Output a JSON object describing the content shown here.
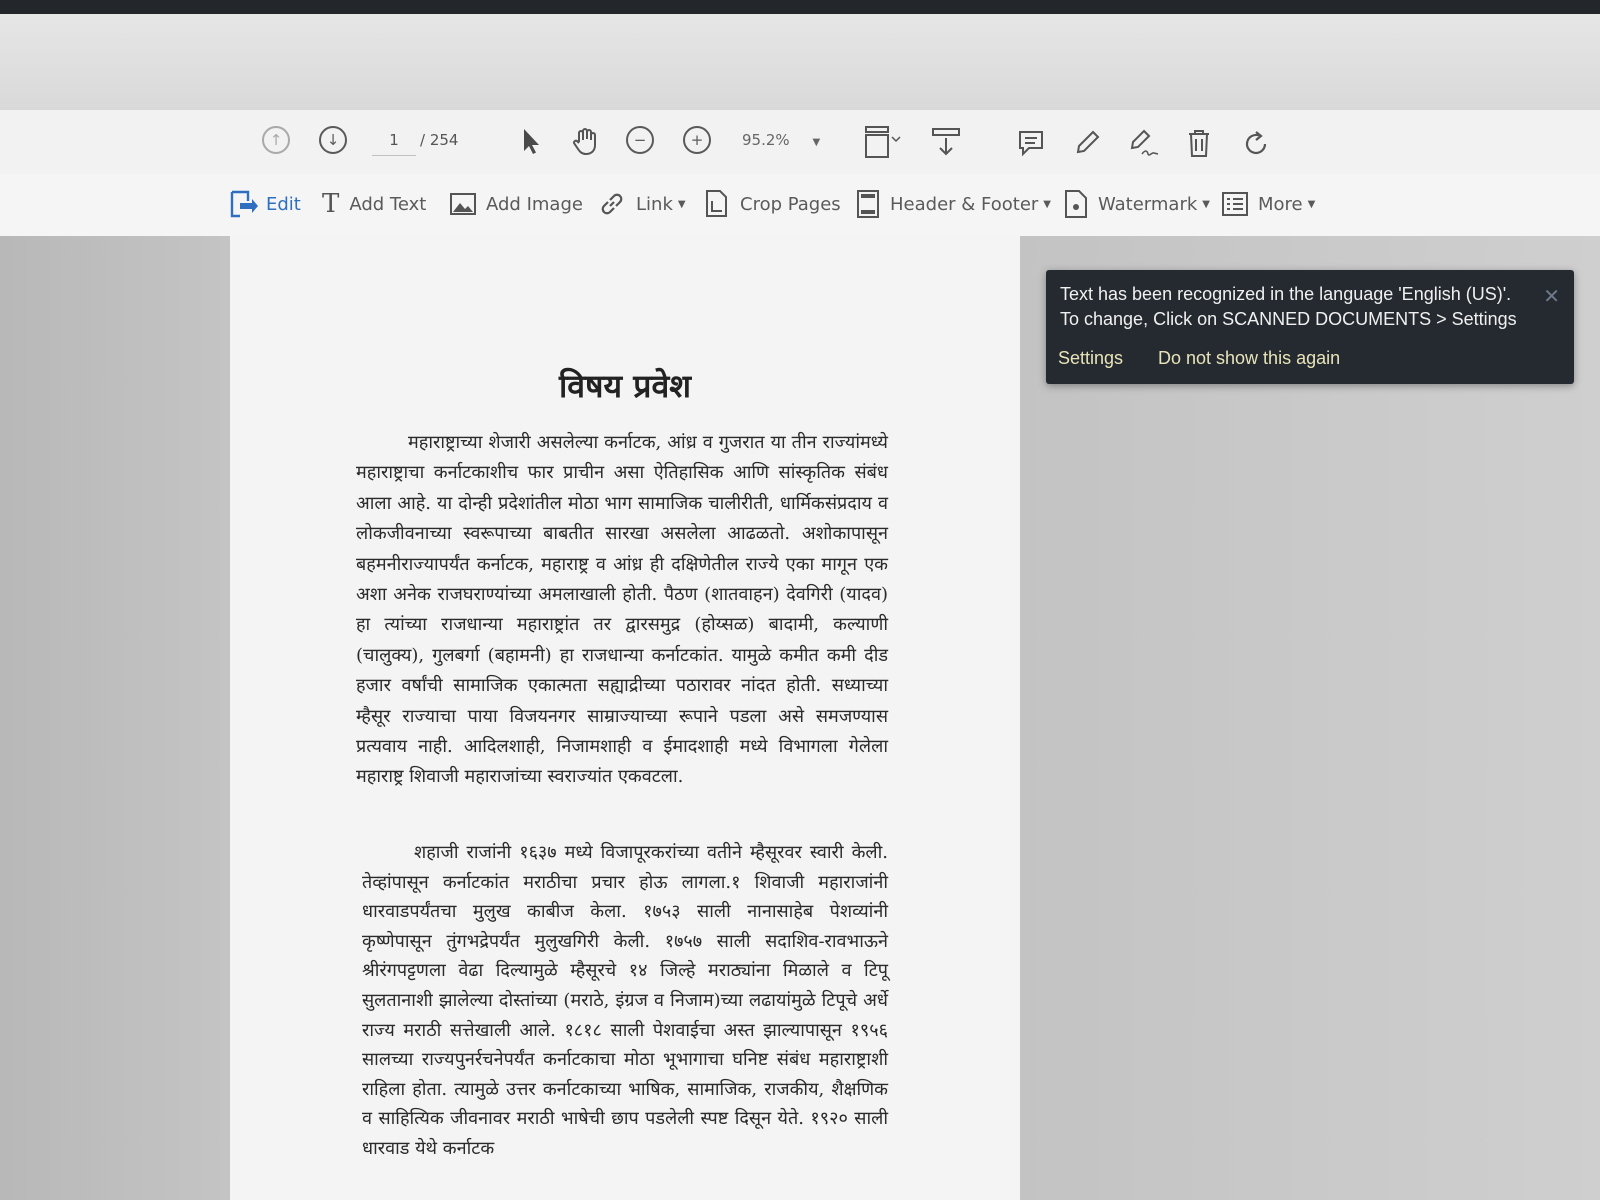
{
  "toolbar": {
    "page_current": "1",
    "page_total": "/ 254",
    "zoom": "95.2%",
    "icons": [
      "prev-page-icon",
      "next-page-icon",
      "select-arrow-icon",
      "hand-icon",
      "zoom-out-icon",
      "zoom-in-icon",
      "fit-page-icon",
      "scroll-mode-icon",
      "comment-icon",
      "highlight-pen-icon",
      "sign-icon",
      "delete-icon",
      "rotate-icon"
    ]
  },
  "edit_toolbar": {
    "edit": "Edit",
    "add_text": "Add Text",
    "add_image": "Add Image",
    "link": "Link",
    "crop_pages": "Crop Pages",
    "header_footer": "Header & Footer",
    "watermark": "Watermark",
    "more": "More"
  },
  "document": {
    "title": "विषय प्रवेश",
    "paragraph1": "महाराष्ट्राच्या शेजारी असलेल्या कर्नाटक, आंध्र व गुजरात या तीन राज्यांमध्ये महाराष्ट्राचा कर्नाटकाशीच फार प्राचीन असा ऐतिहासिक आणि सांस्कृतिक संबंध आला आहे. या दोन्ही प्रदेशांतील मोठा भाग सामाजिक चालीरीती, धार्मिकसंप्रदाय व लोकजीवनाच्या स्वरूपाच्या बाबतीत सारखा असलेला आढळतो. अशोकापासून बहमनीराज्यापर्यंत कर्नाटक, महाराष्ट्र व आंध्र ही दक्षिणेतील राज्ये एका मागून एक अशा अनेक राजघराण्यांच्या अमलाखाली होती. पैठण (शातवाहन) देवगिरी (यादव) हा त्यांच्या राजधान्या महाराष्ट्रांत तर द्वारसमुद्र (होय्सळ) बादामी, कल्याणी (चालुक्य), गुलबर्गा (बहामनी) हा राजधान्या कर्नाटकांत. यामुळे कमीत कमी दीड हजार वर्षांची सामाजिक एकात्मता सह्याद्रीच्या पठारावर नांदत होती. सध्याच्या म्हैसूर राज्याचा पाया विजयनगर साम्राज्याच्या रूपाने पडला असे समजण्यास प्रत्यवाय नाही. आदिलशाही, निजामशाही व ईमादशाही मध्ये विभागला गेलेला महाराष्ट्र शिवाजी महाराजांच्या स्वराज्यांत एकवटला.",
    "paragraph2": "शहाजी राजांनी १६३७ मध्ये विजापूरकरांच्या वतीने म्हैसूरवर स्वारी केली. तेव्हांपासून कर्नाटकांत मराठीचा प्रचार होऊ लागला.१ शिवाजी महाराजांनी धारवाडपर्यंतचा मुलुख काबीज केला. १७५३ साली नानासाहेब पेशव्यांनी कृष्णेपासून तुंगभद्रेपर्यंत मुलुखगिरी केली. १७५७ साली सदाशिव-रावभाऊने श्रीरंगपट्टणला वेढा दिल्यामुळे म्हैसूरचे १४ जिल्हे मराठ्यांना मिळाले व टिपू सुलतानाशी झालेल्या दोस्तांच्या (मराठे, इंग्रज व निजाम)च्या लढायांमुळे टिपूचे अर्धे राज्य मराठी सत्तेखाली आले. १८१८ साली पेशवाईचा अस्त झाल्यापासून १९५६ सालच्या राज्यपुनर्रचनेपर्यंत कर्नाटकाचा मोठा भूभागाचा घनिष्ट संबंध महाराष्ट्राशी राहिला होता. त्यामुळे उत्तर कर्नाटकाच्या भाषिक, सामाजिक, राजकीय, शैक्षणिक व साहित्यिक जीवनावर मराठी भाषेची छाप पडलेली स्पष्ट दिसून येते. १९२० साली धारवाड येथे कर्नाटक"
  },
  "toast": {
    "message": "Text has been recognized in the language 'English (US)'. To change, Click on SCANNED DOCUMENTS > Settings",
    "settings_link": "Settings",
    "dismiss_link": "Do not show this again",
    "close_symbol": "✕"
  }
}
